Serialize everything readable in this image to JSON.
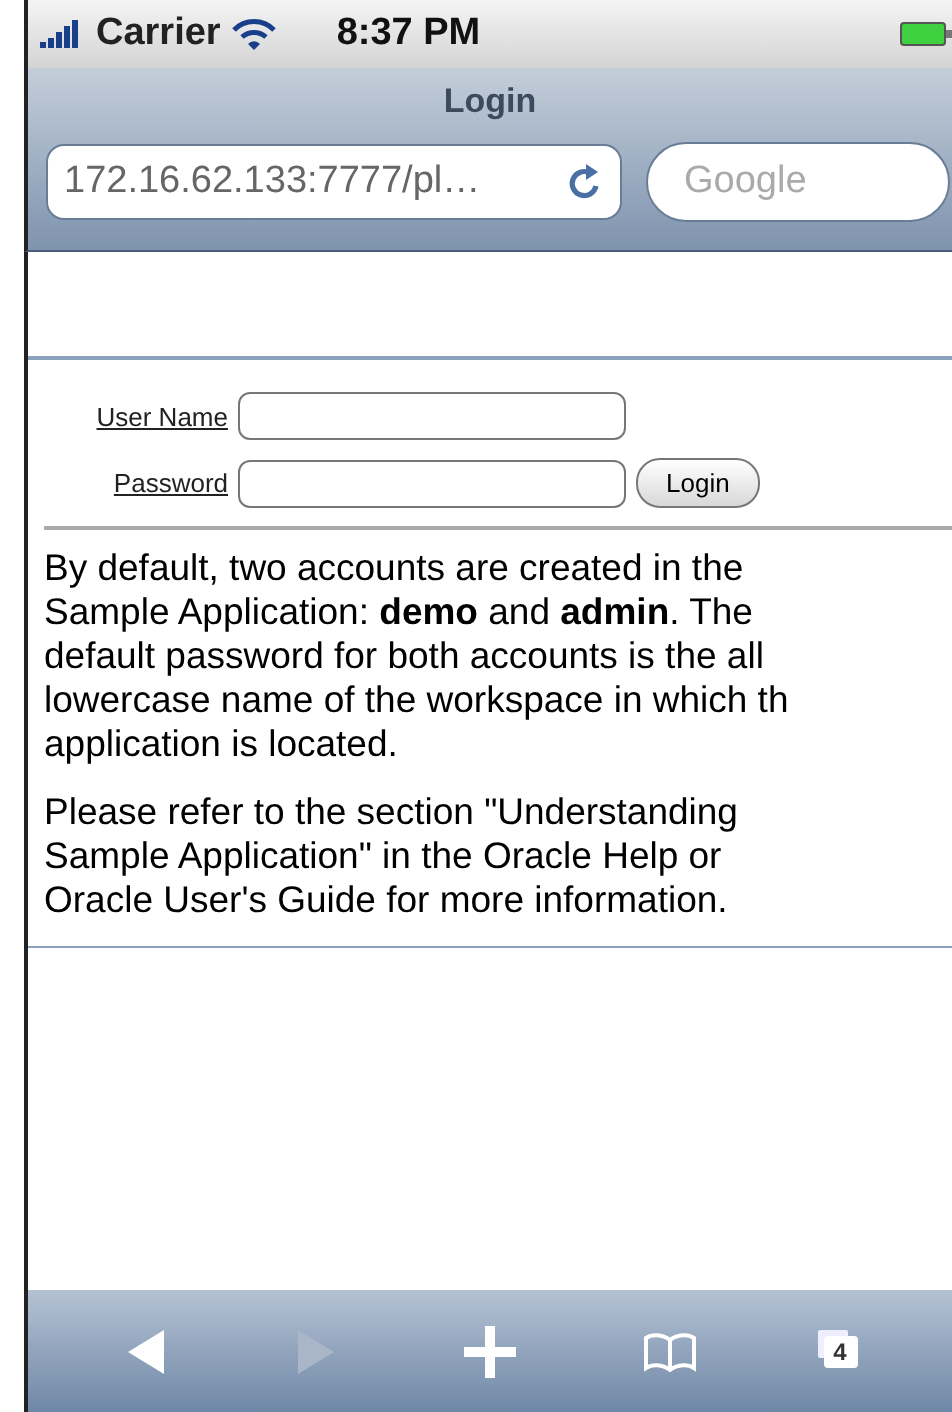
{
  "status_bar": {
    "carrier": "Carrier",
    "time": "8:37 PM"
  },
  "browser": {
    "title": "Login",
    "url": "172.16.62.133:7777/pl…",
    "search": {
      "placeholder": "Google"
    }
  },
  "form": {
    "fields": [
      {
        "label": "User Name"
      },
      {
        "label": "Password"
      }
    ],
    "submit": "Login"
  },
  "paragraphs": [
    [
      "By default, two accounts are created in the",
      "Sample Application: **demo** and **admin**. The",
      "default password for both accounts is the all",
      "lowercase name of the workspace in which th",
      "application is located."
    ],
    [
      "Please refer to the section \"Understanding",
      "Sample Application\" in the Oracle Help or",
      "Oracle User's Guide for more information."
    ]
  ],
  "toolbar": [
    {
      "kind": "back",
      "disabled": false
    },
    {
      "kind": "forward",
      "disabled": true
    },
    {
      "kind": "add",
      "disabled": false
    },
    {
      "kind": "bookmarks",
      "disabled": false
    },
    {
      "kind": "pages",
      "disabled": false,
      "count": "4"
    }
  ]
}
